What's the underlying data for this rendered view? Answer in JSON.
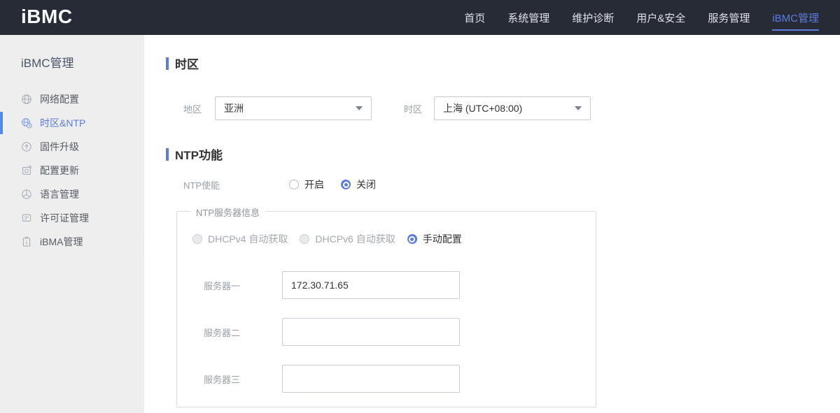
{
  "navbar": {
    "logo": "iBMC",
    "items": [
      {
        "label": "首页",
        "active": false
      },
      {
        "label": "系统管理",
        "active": false
      },
      {
        "label": "维护诊断",
        "active": false
      },
      {
        "label": "用户&安全",
        "active": false
      },
      {
        "label": "服务管理",
        "active": false
      },
      {
        "label": "iBMC管理",
        "active": true
      }
    ]
  },
  "sidebar": {
    "title": "iBMC管理",
    "items": [
      {
        "label": "网络配置",
        "icon": "network-icon",
        "active": false
      },
      {
        "label": "时区&NTP",
        "icon": "timezone-ntp-icon",
        "active": true
      },
      {
        "label": "固件升级",
        "icon": "firmware-upgrade-icon",
        "active": false
      },
      {
        "label": "配置更新",
        "icon": "config-update-icon",
        "active": false
      },
      {
        "label": "语言管理",
        "icon": "language-icon",
        "active": false
      },
      {
        "label": "许可证管理",
        "icon": "license-icon",
        "active": false
      },
      {
        "label": "iBMA管理",
        "icon": "ibma-icon",
        "active": false
      }
    ],
    "collapse_icon": "chevron-left-icon"
  },
  "main": {
    "timezone_section": {
      "title": "时区",
      "region_label": "地区",
      "region_value": "亚洲",
      "timezone_label": "时区",
      "timezone_value": "上海 (UTC+08:00)"
    },
    "ntp_section": {
      "title": "NTP功能",
      "enable_label": "NTP使能",
      "enable_options": [
        {
          "label": "开启",
          "selected": false
        },
        {
          "label": "关闭",
          "selected": true
        }
      ],
      "server_info": {
        "legend": "NTP服务器信息",
        "mode_options": [
          {
            "label": "DHCPv4 自动获取",
            "selected": false,
            "disabled": true
          },
          {
            "label": "DHCPv6 自动获取",
            "selected": false,
            "disabled": true
          },
          {
            "label": "手动配置",
            "selected": true,
            "disabled": false
          }
        ],
        "servers": [
          {
            "label": "服务器一",
            "value": "172.30.71.65"
          },
          {
            "label": "服务器二",
            "value": ""
          },
          {
            "label": "服务器三",
            "value": ""
          }
        ]
      }
    }
  },
  "colors": {
    "accent": "#5e7ce0",
    "navbar_bg": "#272b35",
    "sidebar_bg": "#eeeeee",
    "active_indicator": "#4d8af0"
  }
}
